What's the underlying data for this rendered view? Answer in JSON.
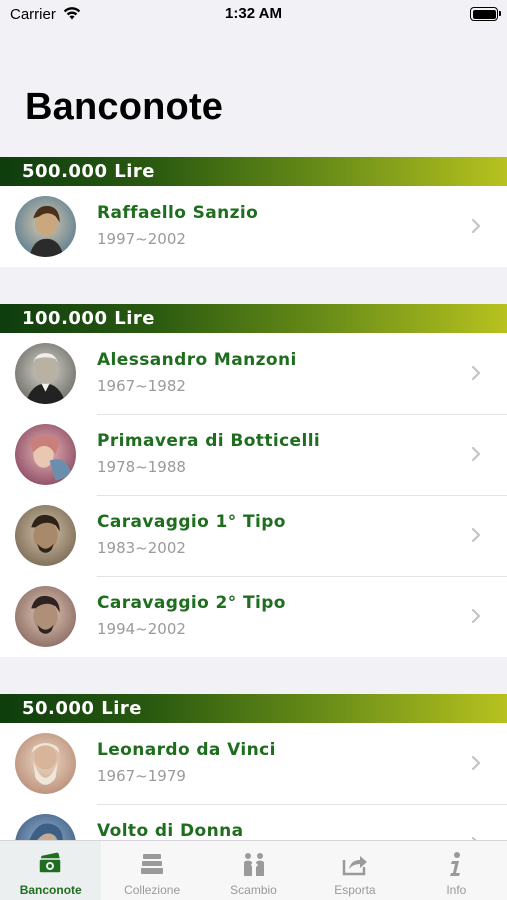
{
  "status": {
    "carrier": "Carrier",
    "time": "1:32 AM"
  },
  "header": {
    "title": "Banconote"
  },
  "sections": [
    {
      "title": "500.000 Lire",
      "items": [
        {
          "title": "Raffaello Sanzio",
          "years": "1997~2002"
        }
      ]
    },
    {
      "title": "100.000 Lire",
      "items": [
        {
          "title": "Alessandro Manzoni",
          "years": "1967~1982"
        },
        {
          "title": "Primavera di Botticelli",
          "years": "1978~1988"
        },
        {
          "title": "Caravaggio 1° Tipo",
          "years": "1983~2002"
        },
        {
          "title": "Caravaggio 2° Tipo",
          "years": "1994~2002"
        }
      ]
    },
    {
      "title": "50.000 Lire",
      "items": [
        {
          "title": "Leonardo da Vinci",
          "years": "1967~1979"
        },
        {
          "title": "Volto di Donna",
          "years": ""
        }
      ]
    }
  ],
  "tabs": [
    {
      "label": "Banconote",
      "icon": "banknote-icon",
      "active": true
    },
    {
      "label": "Collezione",
      "icon": "stack-icon",
      "active": false
    },
    {
      "label": "Scambio",
      "icon": "exchange-icon",
      "active": false
    },
    {
      "label": "Esporta",
      "icon": "share-icon",
      "active": false
    },
    {
      "label": "Info",
      "icon": "info-icon",
      "active": false
    }
  ],
  "colors": {
    "accent": "#1f6e1f",
    "header_gradient_start": "#0e3d0e",
    "header_gradient_end": "#b7c21f"
  }
}
